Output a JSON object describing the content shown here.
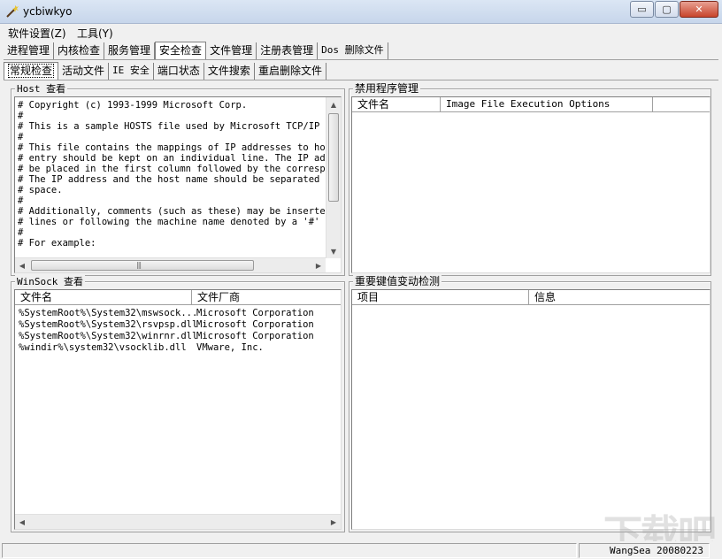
{
  "window": {
    "title": "ycbiwkyo",
    "controls": {
      "minimize": "▭",
      "maximize": "▢",
      "close": "✕"
    }
  },
  "menu": [
    {
      "label": "软件设置(Z)"
    },
    {
      "label": "工具(Y)"
    }
  ],
  "main_tabs": [
    {
      "label": "进程管理"
    },
    {
      "label": "内核检查"
    },
    {
      "label": "服务管理"
    },
    {
      "label": "安全检查",
      "active": true
    },
    {
      "label": "文件管理"
    },
    {
      "label": "注册表管理"
    },
    {
      "label": "Dos 删除文件"
    }
  ],
  "sub_tabs": [
    {
      "label": "常规检查",
      "active": true
    },
    {
      "label": "活动文件"
    },
    {
      "label": "IE 安全"
    },
    {
      "label": "端口状态"
    },
    {
      "label": "文件搜索"
    },
    {
      "label": "重启删除文件"
    }
  ],
  "hosts_panel": {
    "title": "Host 查看",
    "lines": [
      "# Copyright (c) 1993-1999 Microsoft Corp.",
      "#",
      "# This is a sample HOSTS file used by Microsoft TCP/IP for",
      "#",
      "# This file contains the mappings of IP addresses to host",
      "# entry should be kept on an individual line. The IP addre",
      "# be placed in the first column followed by the correspond",
      "# The IP address and the host name should be separated by",
      "# space.",
      "#",
      "# Additionally, comments (such as these) may be inserted o",
      "# lines or following the machine name denoted by a '#' sym",
      "#",
      "# For example:"
    ]
  },
  "disabled_programs_panel": {
    "title": "禁用程序管理",
    "columns": [
      "文件名",
      "Image File Execution Options"
    ]
  },
  "winsock_panel": {
    "title": "WinSock 查看",
    "columns": [
      "文件名",
      "文件厂商"
    ],
    "rows": [
      {
        "file": "%SystemRoot%\\System32\\mswsock...",
        "vendor": "Microsoft Corporation"
      },
      {
        "file": "%SystemRoot%\\System32\\rsvpsp.dll",
        "vendor": "Microsoft Corporation"
      },
      {
        "file": "%SystemRoot%\\System32\\winrnr.dll",
        "vendor": "Microsoft Corporation"
      },
      {
        "file": "%windir%\\system32\\vsocklib.dll",
        "vendor": "VMware, Inc."
      }
    ]
  },
  "registry_panel": {
    "title": "重要键值变动检测",
    "columns": [
      "项目",
      "信息"
    ]
  },
  "status": {
    "text": "WangSea 20080223"
  },
  "watermark": "下载吧",
  "glyphs": {
    "up": "▲",
    "down": "▼",
    "left": "◀",
    "right": "▶",
    "grip": "|||"
  }
}
